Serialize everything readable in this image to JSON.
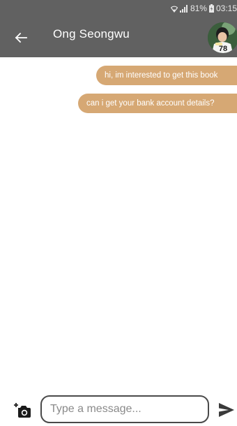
{
  "status_bar": {
    "battery": "81%",
    "time": "03:15"
  },
  "header": {
    "contact_name": "Ong Seongwu",
    "avatar_jersey_number": "78"
  },
  "messages": [
    {
      "text": "hi, im interested to get this book",
      "direction": "outgoing"
    },
    {
      "text": "can i get your bank account details?",
      "direction": "outgoing"
    }
  ],
  "composer": {
    "placeholder": "Type a message...",
    "value": ""
  },
  "colors": {
    "app_bar": "#616161",
    "bubble": "#d6a874",
    "bubble_text": "#ffffff"
  },
  "icons": {
    "back": "arrow-left-icon",
    "camera": "camera-add-icon",
    "send": "send-icon"
  }
}
